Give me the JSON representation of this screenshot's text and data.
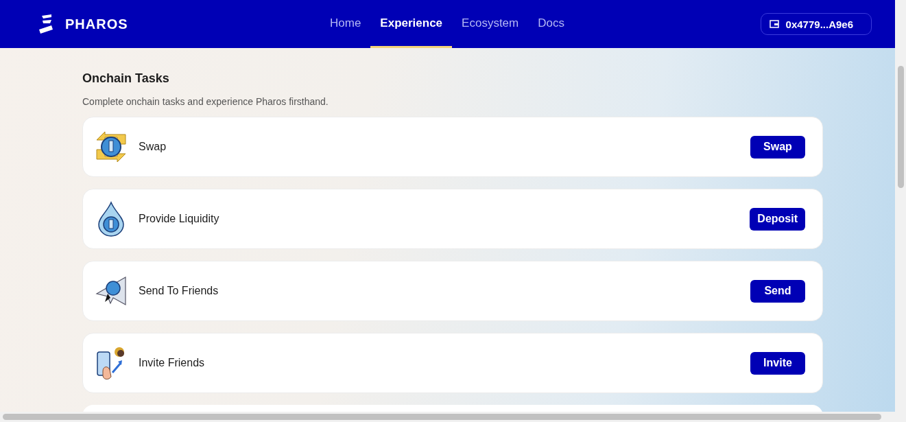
{
  "header": {
    "brand": "PHAROS",
    "nav": [
      {
        "label": "Home",
        "selected": false
      },
      {
        "label": "Experience",
        "selected": true
      },
      {
        "label": "Ecosystem",
        "selected": false
      },
      {
        "label": "Docs",
        "selected": false
      }
    ],
    "wallet": "0x4779...A9e6"
  },
  "section": {
    "title": "Onchain Tasks",
    "subtitle": "Complete onchain tasks and experience Pharos firsthand."
  },
  "tasks": [
    {
      "kind": "swap",
      "title": "Swap",
      "action": "Swap"
    },
    {
      "kind": "liquidity",
      "title": "Provide Liquidity",
      "action": "Deposit"
    },
    {
      "kind": "send",
      "title": "Send To Friends",
      "action": "Send"
    },
    {
      "kind": "invite",
      "title": "Invite Friends",
      "action": "Invite"
    }
  ]
}
